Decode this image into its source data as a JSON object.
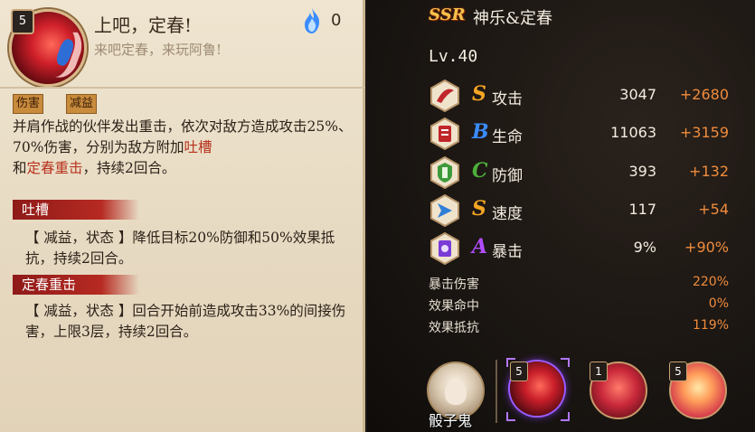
{
  "skill": {
    "level": "5",
    "title": "上吧，定春!",
    "subtitle": "来吧定春，来玩阿鲁!",
    "fire_cost": "0",
    "tags": [
      "伤害",
      "减益"
    ],
    "desc_1": "并肩作战的伙伴发出重击，依次对敌方造成攻击25%、70%伤害，分别为敌方附加",
    "desc_hl1": "吐槽",
    "desc_2": "和",
    "desc_hl2": "定春重击",
    "desc_3": "，持续2回合。",
    "effects": [
      {
        "name": "吐槽",
        "text": "【 减益，状态 】降低目标20%防御和50%效果抵抗，持续2回合。"
      },
      {
        "name": "定春重击",
        "text": "【 减益，状态 】回合开始前造成攻击33%的间接伤害，上限3层，持续2回合。"
      }
    ]
  },
  "hero": {
    "rarity": "SSR",
    "name": "神乐&定春",
    "level": "Lv.40"
  },
  "stats": [
    {
      "grade": "S",
      "grade_color": "#f5a623",
      "name": "攻击",
      "base": "3047",
      "bonus": "+2680",
      "icon": "attack-icon"
    },
    {
      "grade": "B",
      "grade_color": "#3a8cff",
      "name": "生命",
      "base": "11063",
      "bonus": "+3159",
      "icon": "health-icon"
    },
    {
      "grade": "C",
      "grade_color": "#4caf3a",
      "name": "防御",
      "base": "393",
      "bonus": "+132",
      "icon": "defense-icon"
    },
    {
      "grade": "S",
      "grade_color": "#f5a623",
      "name": "速度",
      "base": "117",
      "bonus": "+54",
      "icon": "speed-icon"
    },
    {
      "grade": "A",
      "grade_color": "#b24cff",
      "name": "暴击",
      "base": "9%",
      "bonus": "+90%",
      "icon": "crit-icon"
    }
  ],
  "sub_stats": [
    {
      "name": "暴击伤害",
      "value": "220%"
    },
    {
      "name": "效果命中",
      "value": "0%"
    },
    {
      "name": "效果抵抗",
      "value": "119%"
    }
  ],
  "partner": {
    "name": "骰子鬼"
  },
  "skill_slots": [
    {
      "level": "5",
      "selected": true
    },
    {
      "level": "1",
      "selected": false
    },
    {
      "level": "5",
      "selected": false
    }
  ]
}
